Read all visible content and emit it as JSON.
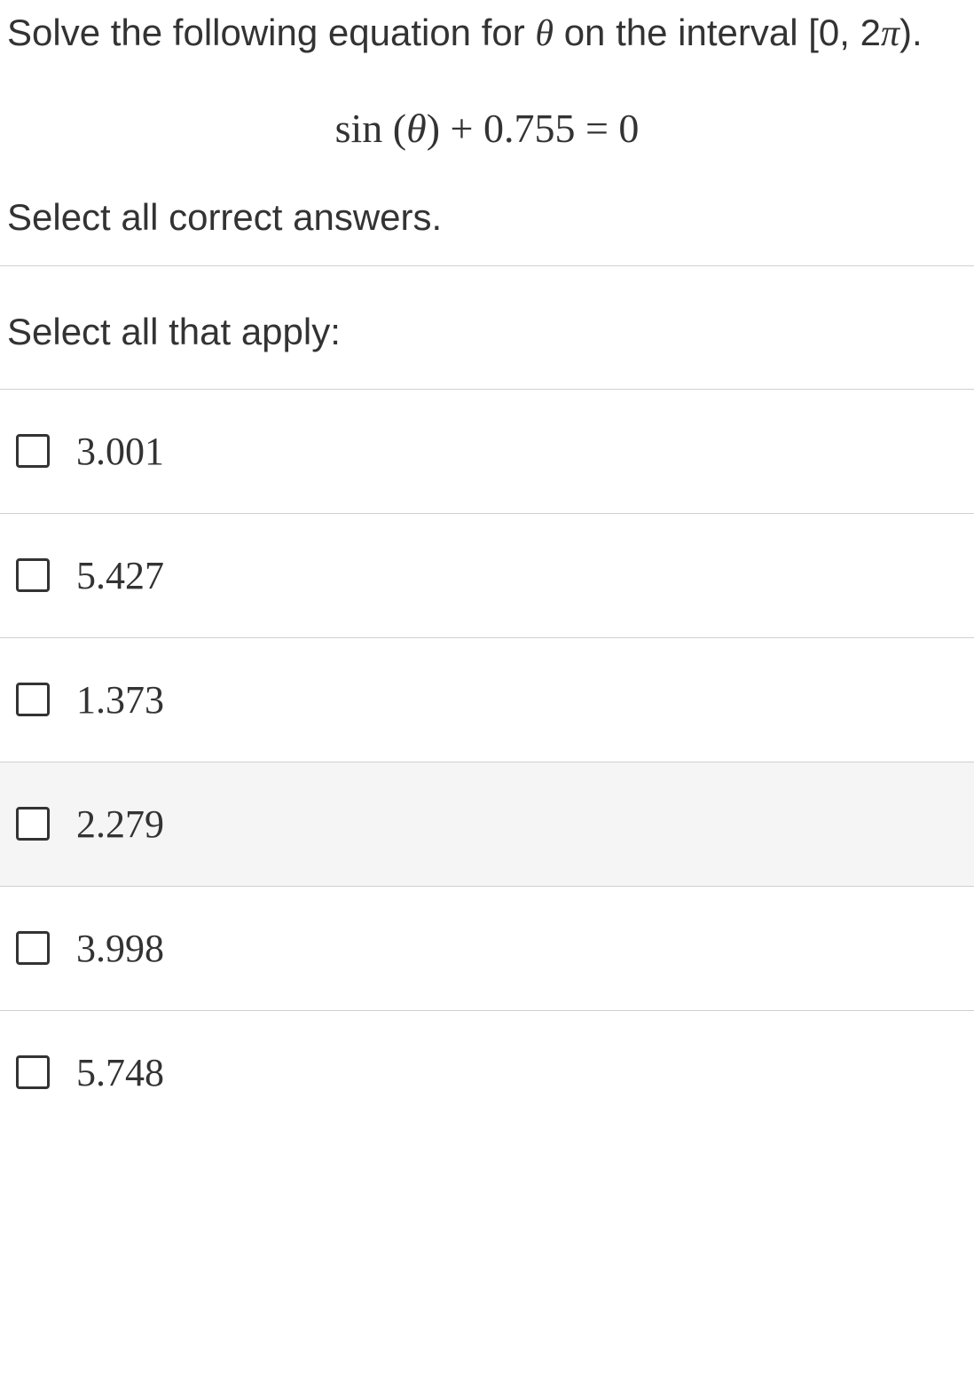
{
  "question": {
    "prompt_pre": "Solve the following equation for ",
    "theta": "θ",
    "prompt_post": " on the interval [0, 2",
    "pi": "π",
    "prompt_end": ").",
    "equation_sin": "sin (",
    "equation_theta": "θ",
    "equation_rest": ") + 0.755 = 0",
    "instruction": "Select all correct answers.",
    "subheading": "Select all that apply:"
  },
  "options": [
    {
      "label": "3.001",
      "checked": false,
      "highlighted": false
    },
    {
      "label": "5.427",
      "checked": false,
      "highlighted": false
    },
    {
      "label": "1.373",
      "checked": false,
      "highlighted": false
    },
    {
      "label": "2.279",
      "checked": false,
      "highlighted": true
    },
    {
      "label": "3.998",
      "checked": false,
      "highlighted": false
    },
    {
      "label": "5.748",
      "checked": false,
      "highlighted": false
    }
  ]
}
